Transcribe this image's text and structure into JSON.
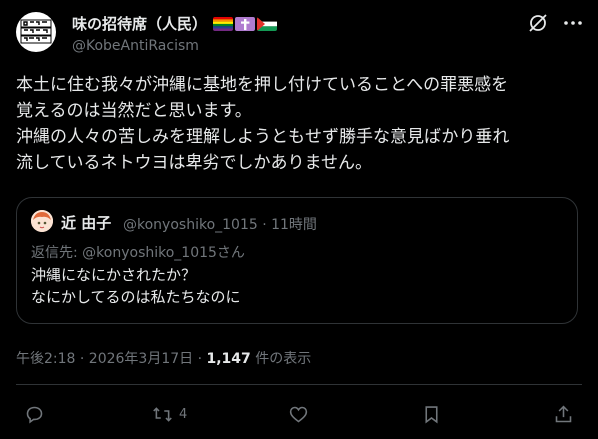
{
  "author": {
    "display_name": "味の招待席（人民）",
    "handle": "@KobeAntiRacism",
    "avatar_text": [
      "人民に手を",
      "平和と連帯",
      "日本に革命を"
    ],
    "flag_icons": [
      "rainbow-flag-icon",
      "cross-icon",
      "palestine-flag-icon"
    ]
  },
  "tweet": {
    "text": "本土に住む我々が沖縄に基地を押し付けていることへの罪悪感を\n覚えるのは当然だと思います。\n沖縄の人々の苦しみを理解しようともせず勝手な意見ばかり垂れ\n流しているネトウヨは卑劣でしかありません。"
  },
  "quote": {
    "display_name": "近 由子",
    "handle": "@konyoshiko_1015",
    "time": "· 11時間",
    "reply_to": "返信先: @konyoshiko_1015さん",
    "text": "沖縄になにかされたか？\nなにかしてるのは私たちなのに"
  },
  "meta": {
    "timestamp": "午後2:18 · 2026年3月17日 · ",
    "views_count": "1,147",
    "views_label": " 件の表示"
  },
  "actions": {
    "reply_count": "",
    "repost_count": "4",
    "like_count": "",
    "bookmark_count": ""
  },
  "colors": {
    "background": "#000000",
    "text": "#e7e9ea",
    "secondary": "#71767b",
    "border": "#2f3336"
  }
}
